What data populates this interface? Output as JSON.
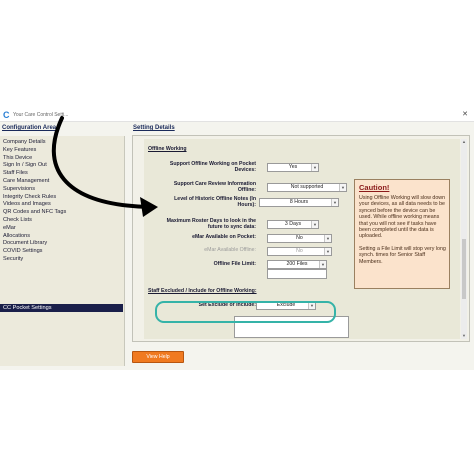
{
  "window": {
    "title": "Your Care Control Setti..."
  },
  "left_panel": {
    "header": "Configuration Area",
    "items": [
      "Company Details",
      "Key Features",
      "This Device",
      "Sign In / Sign Out",
      "Staff Files",
      "Care Management",
      "Supervisions",
      "Integrity Check Rules",
      "Videos and Images",
      "QR Codes and NFC Tags",
      "Check Lists",
      "eMar",
      "Allocations",
      "Document Library",
      "COVID Settings",
      "Security"
    ],
    "selected": "CC Pocket Settings"
  },
  "settings": {
    "header": "Setting Details",
    "offline_section": "Offline Working",
    "rows": {
      "support_offline": {
        "label": "Support Offline Working on Pocket Devices:",
        "value": "Yes"
      },
      "care_review": {
        "label": "Support Care Review Information Offline:",
        "value": "Not supported"
      },
      "historic_notes": {
        "label": "Level of Historic Offline Notes (In Hours):",
        "value": "8 Hours"
      },
      "roster_days": {
        "label": "Maximum Roster Days to look in the future to sync data:",
        "value": "3 Days"
      },
      "emar_pocket": {
        "label": "eMar Available on Pocket:",
        "value": "No"
      },
      "emar_offline": {
        "label": "eMar Available Offline:",
        "value": "No"
      },
      "file_limit": {
        "label": "Offline File Limit:",
        "value": "200 Files"
      }
    },
    "staff_section": "Staff Excluded / Include for Offline Working:",
    "exclude_row": {
      "label": "Set Exclude or Include:",
      "value": "Exclude"
    }
  },
  "caution": {
    "title": "Caution!",
    "paragraphs": [
      "Using Offline Working will slow down your devices, as all data needs to be synced before the device can be used.  While offline working means that you will not see if tasks have been completed until the data is uploaded.",
      "Setting a File Limit will stop very long synch. times for Senior Staff Members."
    ]
  },
  "buttons": {
    "view_help": "View Help"
  },
  "colors": {
    "highlight": "#35b3a8",
    "view_help": "#f07a20",
    "selected_nav": "#1a1f4a",
    "caution_bg": "#fbe3cc"
  }
}
